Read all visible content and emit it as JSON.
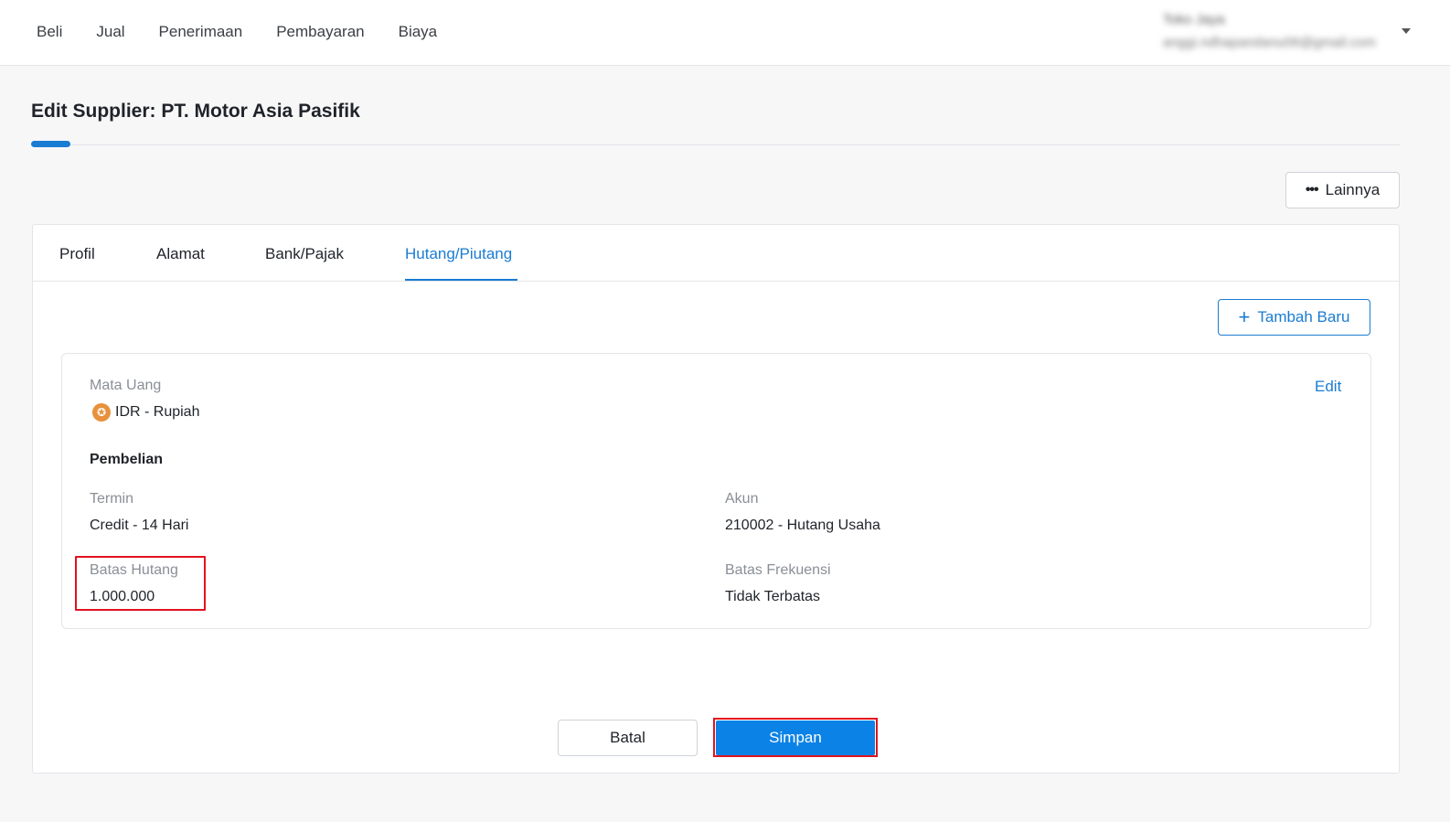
{
  "topnav": {
    "items": [
      "Beli",
      "Jual",
      "Penerimaan",
      "Pembayaran",
      "Biaya"
    ],
    "user_name": "Toko Jaya",
    "user_email": "anggi.ndhapandanu06@gmail.com"
  },
  "page": {
    "title": "Edit Supplier: PT. Motor Asia Pasifik",
    "more_button": "Lainnya"
  },
  "tabs": [
    "Profil",
    "Alamat",
    "Bank/Pajak",
    "Hutang/Piutang"
  ],
  "active_tab": "Hutang/Piutang",
  "add_button": "Tambah Baru",
  "detail": {
    "currency_label": "Mata Uang",
    "currency_value": "IDR - Rupiah",
    "edit_link": "Edit",
    "section_title": "Pembelian",
    "termin_label": "Termin",
    "termin_value": "Credit - 14 Hari",
    "akun_label": "Akun",
    "akun_value": "210002 - Hutang Usaha",
    "batas_hutang_label": "Batas Hutang",
    "batas_hutang_value": "1.000.000",
    "batas_frekuensi_label": "Batas Frekuensi",
    "batas_frekuensi_value": "Tidak Terbatas"
  },
  "footer": {
    "cancel": "Batal",
    "save": "Simpan"
  },
  "colors": {
    "accent": "#1a7cd3",
    "primary_button": "#0b82e6",
    "highlight": "#e0141e"
  }
}
